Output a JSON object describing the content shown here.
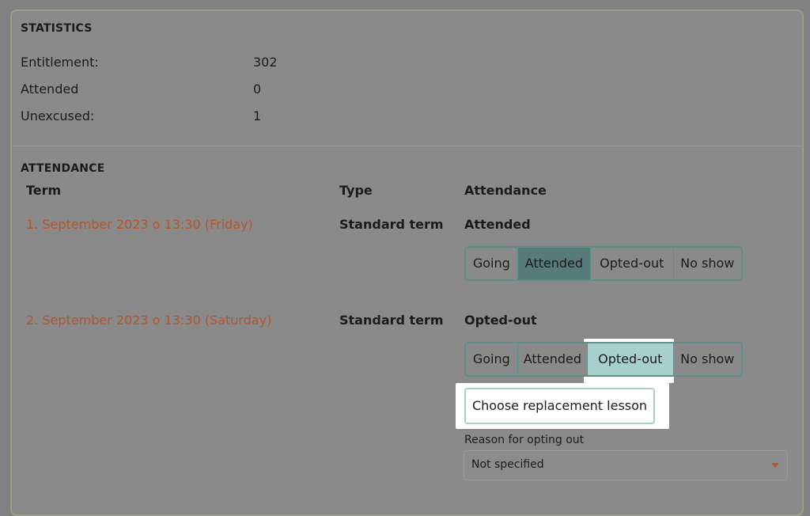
{
  "statistics": {
    "title": "STATISTICS",
    "rows": [
      {
        "label": "Entitlement:",
        "value": "302"
      },
      {
        "label": "Attended",
        "value": "0"
      },
      {
        "label": "Unexcused:",
        "value": "1"
      }
    ]
  },
  "attendance": {
    "title": "ATTENDANCE",
    "columns": {
      "term": "Term",
      "type": "Type",
      "attendance": "Attendance"
    },
    "rows": [
      {
        "term": "1. September 2023 o 13:30 (Friday)",
        "type": "Standard term",
        "status": "Attended",
        "options": [
          "Going",
          "Attended",
          "Opted-out",
          "No show"
        ],
        "selected": "Attended"
      },
      {
        "term": "2. September 2023 o 13:30 (Saturday)",
        "type": "Standard term",
        "status": "Opted-out",
        "options": [
          "Going",
          "Attended",
          "Opted-out",
          "No show"
        ],
        "selected": "Opted-out",
        "replacement_button": "Choose replacement lesson",
        "reason_label": "Reason for opting out",
        "reason_value": "Not specified"
      }
    ]
  },
  "colors": {
    "overlay_background": "#818181",
    "term_link": "#b5542a",
    "segment_border": "#5f8e8a",
    "attended_active": "#577b78",
    "opted_out_active": "#a8d0cb",
    "highlight": "#ffffff"
  }
}
